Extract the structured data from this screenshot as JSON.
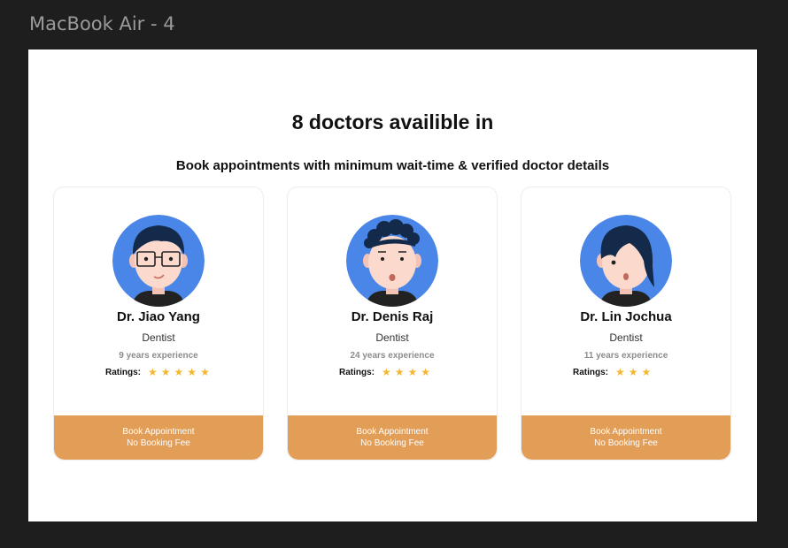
{
  "window": {
    "frame_label": "MacBook Air - 4"
  },
  "page": {
    "headline": "8 doctors availible in",
    "subheadline": "Book appointments with minimum wait-time & verified doctor details"
  },
  "theme": {
    "accent": "#e29d57",
    "star_color": "#f5b731",
    "avatar_bg": "#4a86e8"
  },
  "doctors": [
    {
      "name": "Dr. Jiao Yang",
      "specialty": "Dentist",
      "experience": "9 years experience",
      "ratings_label": "Ratings:",
      "rating": 5,
      "star_glyph": "★",
      "avatar_icon": "doctor-avatar-glasses-icon",
      "button_line1": "Book Appointment",
      "button_line2": "No Booking Fee"
    },
    {
      "name": "Dr. Denis Raj",
      "specialty": "Dentist",
      "experience": "24 years experience",
      "ratings_label": "Ratings:",
      "rating": 4,
      "star_glyph": "★",
      "avatar_icon": "doctor-avatar-curly-hair-icon",
      "button_line1": "Book Appointment",
      "button_line2": "No Booking Fee"
    },
    {
      "name": "Dr. Lin Jochua",
      "specialty": "Dentist",
      "experience": "11 years experience",
      "ratings_label": "Ratings:",
      "rating": 3,
      "star_glyph": "★",
      "avatar_icon": "doctor-avatar-long-bangs-icon",
      "button_line1": "Book Appointment",
      "button_line2": "No Booking Fee"
    }
  ]
}
